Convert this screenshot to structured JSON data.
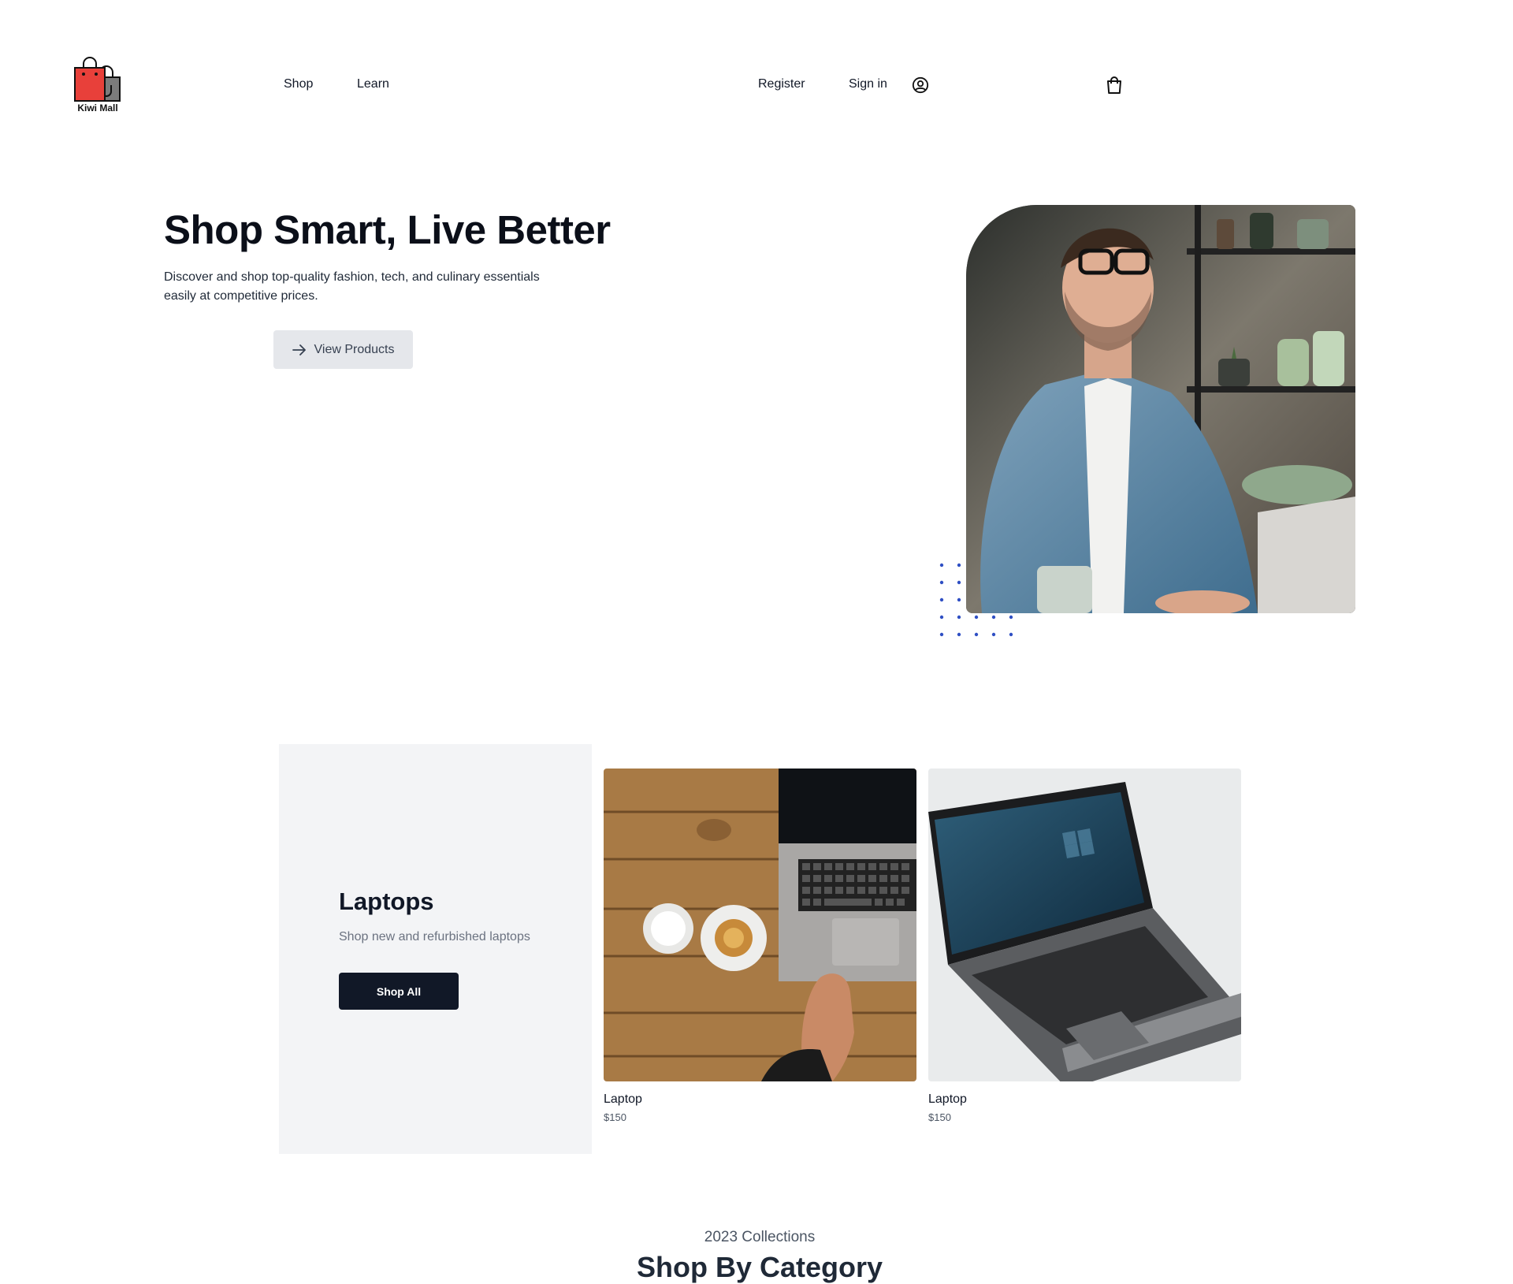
{
  "brand": {
    "name": "Kiwi Mall"
  },
  "nav": {
    "shop": "Shop",
    "learn": "Learn",
    "register": "Register",
    "sign_in": "Sign in",
    "user_icon": "user-circle-icon",
    "cart_icon": "shopping-bag-icon"
  },
  "hero": {
    "title": "Shop Smart, Live Better",
    "description": "Discover and shop top-quality fashion, tech, and culinary essentials easily at competitive prices.",
    "button_label": "View Products",
    "button_icon": "arrow-right-icon"
  },
  "category_feature": {
    "title": "Laptops",
    "subtitle": "Shop new and refurbished laptops",
    "button_label": "Shop All",
    "products": [
      {
        "name": "Laptop",
        "price": "$150"
      },
      {
        "name": "Laptop",
        "price": "$150"
      }
    ]
  },
  "collections": {
    "label": "2023 Collections",
    "title": "Shop By Category"
  },
  "colors": {
    "primary_dark": "#111827",
    "panel_bg": "#f3f4f6",
    "button_light": "#e5e7eb",
    "dot_accent": "#2f4fc4",
    "logo_red": "#e8403a"
  }
}
